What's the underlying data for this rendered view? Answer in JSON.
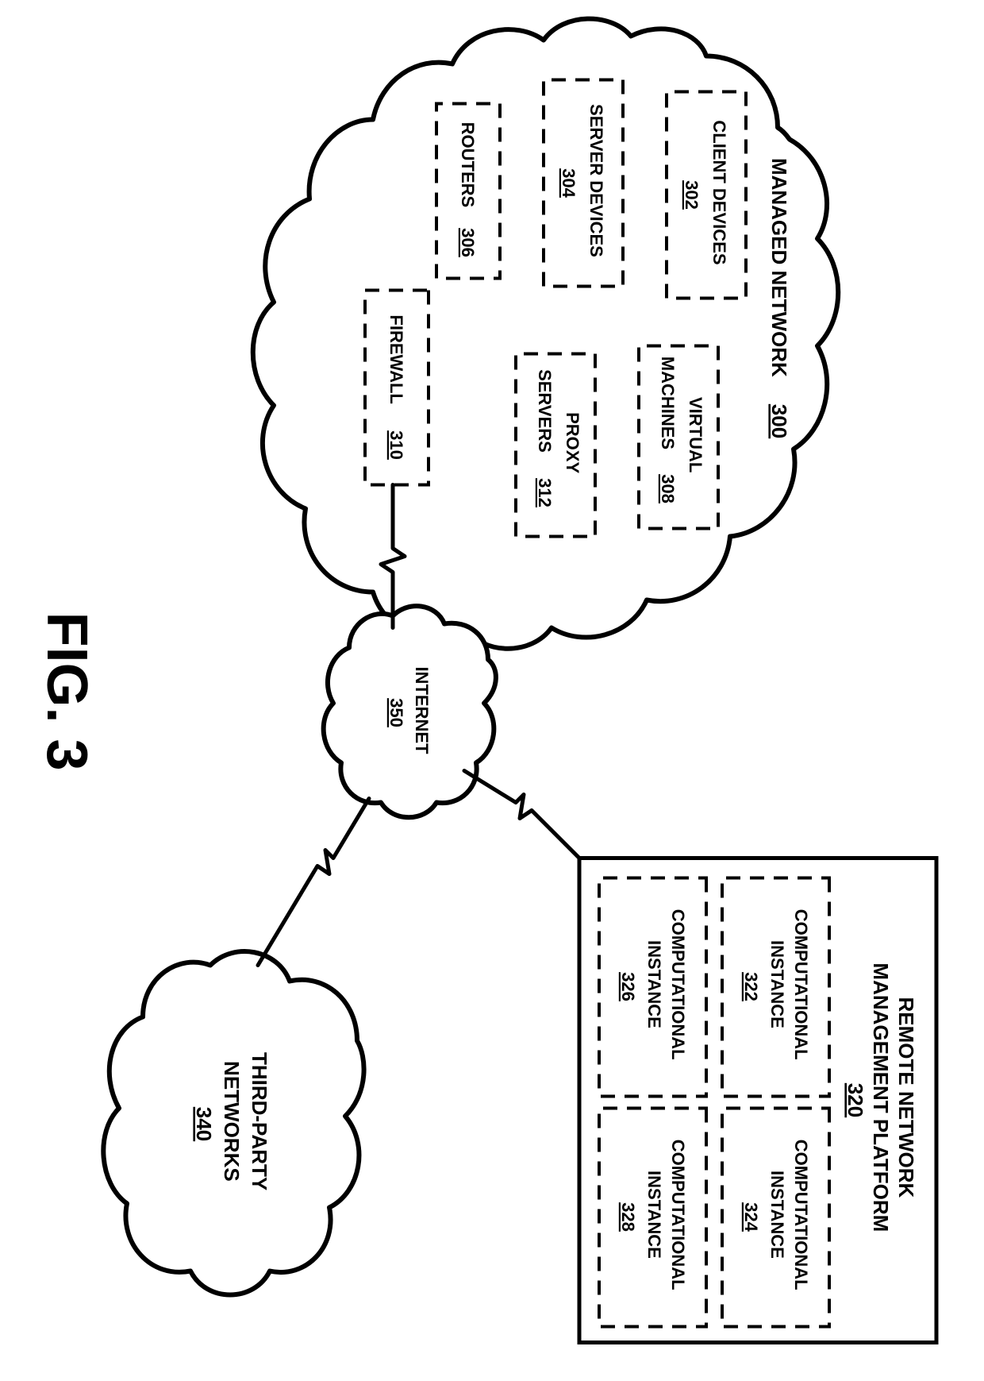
{
  "figure_label": "FIG. 3",
  "managed_network": {
    "title": "MANAGED NETWORK",
    "ref": "300",
    "client_devices": {
      "label": "CLIENT DEVICES",
      "ref": "302"
    },
    "server_devices": {
      "label": "SERVER DEVICES",
      "ref": "304"
    },
    "routers": {
      "label": "ROUTERS",
      "ref": "306"
    },
    "virtual_machines": {
      "label_line1": "VIRTUAL",
      "label_line2": "MACHINES",
      "ref": "308"
    },
    "proxy_servers": {
      "label_line1": "PROXY",
      "label_line2": "SERVERS",
      "ref": "312"
    },
    "firewall": {
      "label": "FIREWALL",
      "ref": "310"
    }
  },
  "remote_platform": {
    "title_line1": "REMOTE NETWORK",
    "title_line2": "MANAGEMENT PLATFORM",
    "ref": "320",
    "instances": [
      {
        "label_line1": "COMPUTATIONAL",
        "label_line2": "INSTANCE",
        "ref": "322"
      },
      {
        "label_line1": "COMPUTATIONAL",
        "label_line2": "INSTANCE",
        "ref": "324"
      },
      {
        "label_line1": "COMPUTATIONAL",
        "label_line2": "INSTANCE",
        "ref": "326"
      },
      {
        "label_line1": "COMPUTATIONAL",
        "label_line2": "INSTANCE",
        "ref": "328"
      }
    ]
  },
  "third_party": {
    "label_line1": "THIRD-PARTY",
    "label_line2": "NETWORKS",
    "ref": "340"
  },
  "internet": {
    "label": "INTERNET",
    "ref": "350"
  }
}
